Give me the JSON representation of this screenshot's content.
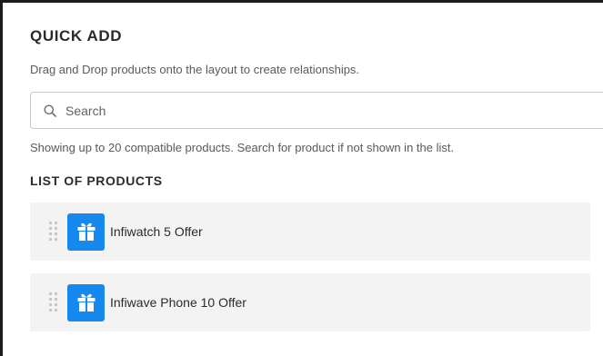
{
  "quick_add": {
    "title": "QUICK ADD",
    "subtitle": "Drag and Drop products onto the layout to create relationships.",
    "search": {
      "placeholder": "Search",
      "value": "",
      "icon": "search-icon"
    },
    "hint": "Showing up to 20 compatible products. Search for product if not shown in the list.",
    "list_title": "LIST OF PRODUCTS",
    "products": [
      {
        "label": "Infiwatch 5 Offer",
        "icon": "gift-icon"
      },
      {
        "label": "Infiwave Phone 10 Offer",
        "icon": "gift-icon"
      }
    ]
  },
  "colors": {
    "accent": "#1589ee",
    "row_bg": "#f3f3f3",
    "border": "#c9c9c9"
  }
}
